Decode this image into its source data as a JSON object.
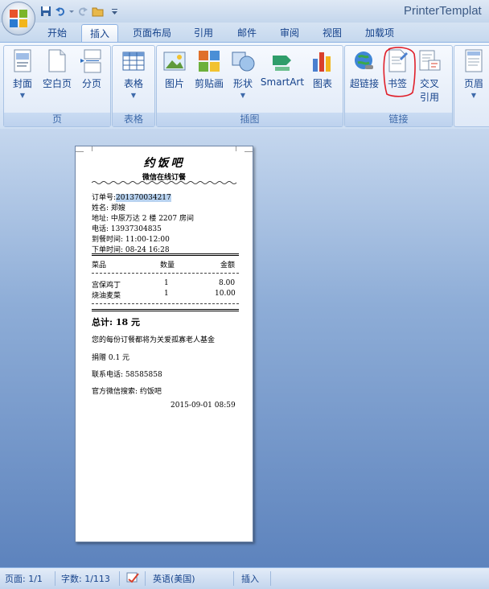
{
  "window": {
    "title": "PrinterTemplat"
  },
  "tabs": [
    "开始",
    "插入",
    "页面布局",
    "引用",
    "邮件",
    "审阅",
    "视图",
    "加载项"
  ],
  "ribbon": {
    "groups": {
      "pages": "页",
      "tables": "表格",
      "illustrations": "插图",
      "links": "链接"
    },
    "buttons": {
      "cover": "封面",
      "blank": "空白页",
      "pagebreak": "分页",
      "table": "表格",
      "picture": "图片",
      "clipart": "剪贴画",
      "shapes": "形状",
      "smartart": "SmartArt",
      "chart": "图表",
      "hyperlink": "超链接",
      "bookmark": "书签",
      "crossref_1": "交叉",
      "crossref_2": "引用",
      "header": "页眉"
    }
  },
  "document": {
    "title": "约饭吧",
    "subtitle": "微信在线订餐",
    "order_no_label": "订单号:",
    "order_no": "201370034217",
    "name": "姓名: 郑嫂",
    "address": "地址: 中原万达 2 楼 2207 房间",
    "phone": "电话: 13937304835",
    "delivery": "到餐时间: 11:00-12:00",
    "order_time": "下单时间: 08-24 16:28",
    "headers": [
      "菜品",
      "数量",
      "金额"
    ],
    "items": [
      {
        "name": "宫保鸡丁",
        "qty": "1",
        "amount": "8.00"
      },
      {
        "name": "烧油麦菜",
        "qty": "1",
        "amount": "10.00"
      }
    ],
    "total": "总计: 18 元",
    "donation_1": "您的每份订餐都将为关爱孤寡老人基金",
    "donation_2": "捐赠 0.1 元",
    "contact": "联系电话: 58585858",
    "wechat": "官方微信搜索: 约饭吧",
    "datetime": "2015-09-01 08:59"
  },
  "status": {
    "page": "页面: 1/1",
    "words": "字数: 1/113",
    "lang": "英语(美国)",
    "mode": "插入"
  }
}
